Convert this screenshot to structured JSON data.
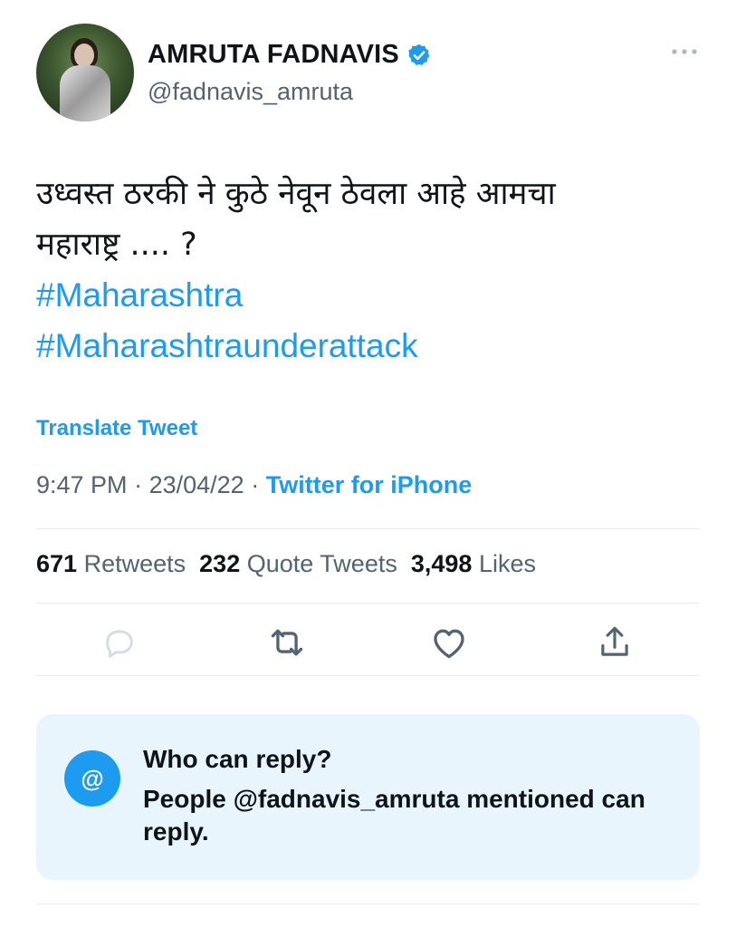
{
  "author": {
    "name": "AMRUTA FADNAVIS",
    "handle": "@fadnavis_amruta",
    "verified_icon": "verified-badge-icon"
  },
  "tweet": {
    "text_line1": "उध्वस्त ठरकी ने कुठे नेवून ठेवला आहे आमचा",
    "text_line2": "महाराष्ट्र .... ?",
    "hashtags": [
      "#Maharashtra",
      "#Maharashtraunderattack"
    ],
    "translate_label": "Translate Tweet",
    "time": "9:47 PM",
    "date": "23/04/22",
    "separator": "·",
    "source": "Twitter for iPhone"
  },
  "stats": {
    "retweets_count": "671",
    "retweets_label": "Retweets",
    "quotes_count": "232",
    "quotes_label": "Quote Tweets",
    "likes_count": "3,498",
    "likes_label": "Likes"
  },
  "actions": [
    "reply-icon",
    "retweet-icon",
    "like-icon",
    "share-icon"
  ],
  "reply_card": {
    "icon_glyph": "@",
    "title": "Who can reply?",
    "description": "People @fadnavis_amruta mentioned can reply."
  },
  "colors": {
    "accent": "#1d9bf0",
    "muted": "#536471",
    "card_bg": "#e8f5fd"
  }
}
